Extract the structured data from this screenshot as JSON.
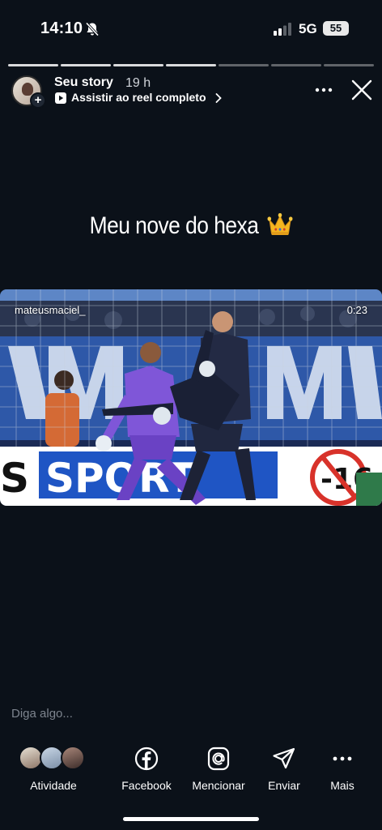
{
  "status_bar": {
    "time": "14:10",
    "network": "5G",
    "battery": "55"
  },
  "progress": {
    "segments": 7,
    "completed": 4
  },
  "header": {
    "title": "Seu story",
    "time_ago": "19 h",
    "reel_link": "Assistir ao reel completo"
  },
  "caption": {
    "text": "Meu nove do hexa"
  },
  "reel": {
    "username": "mateusmaciel_",
    "duration": "0:23"
  },
  "reply": {
    "placeholder": "Diga algo..."
  },
  "actions": [
    {
      "label": "Atividade",
      "icon": "activity-avatars"
    },
    {
      "label": "Facebook",
      "icon": "facebook-icon"
    },
    {
      "label": "Mencionar",
      "icon": "mention-icon"
    },
    {
      "label": "Enviar",
      "icon": "send-icon"
    },
    {
      "label": "Mais",
      "icon": "more-horizontal-icon"
    }
  ],
  "colors": {
    "background": "#0b1119",
    "text": "#ffffff",
    "muted": "#7d848e"
  }
}
